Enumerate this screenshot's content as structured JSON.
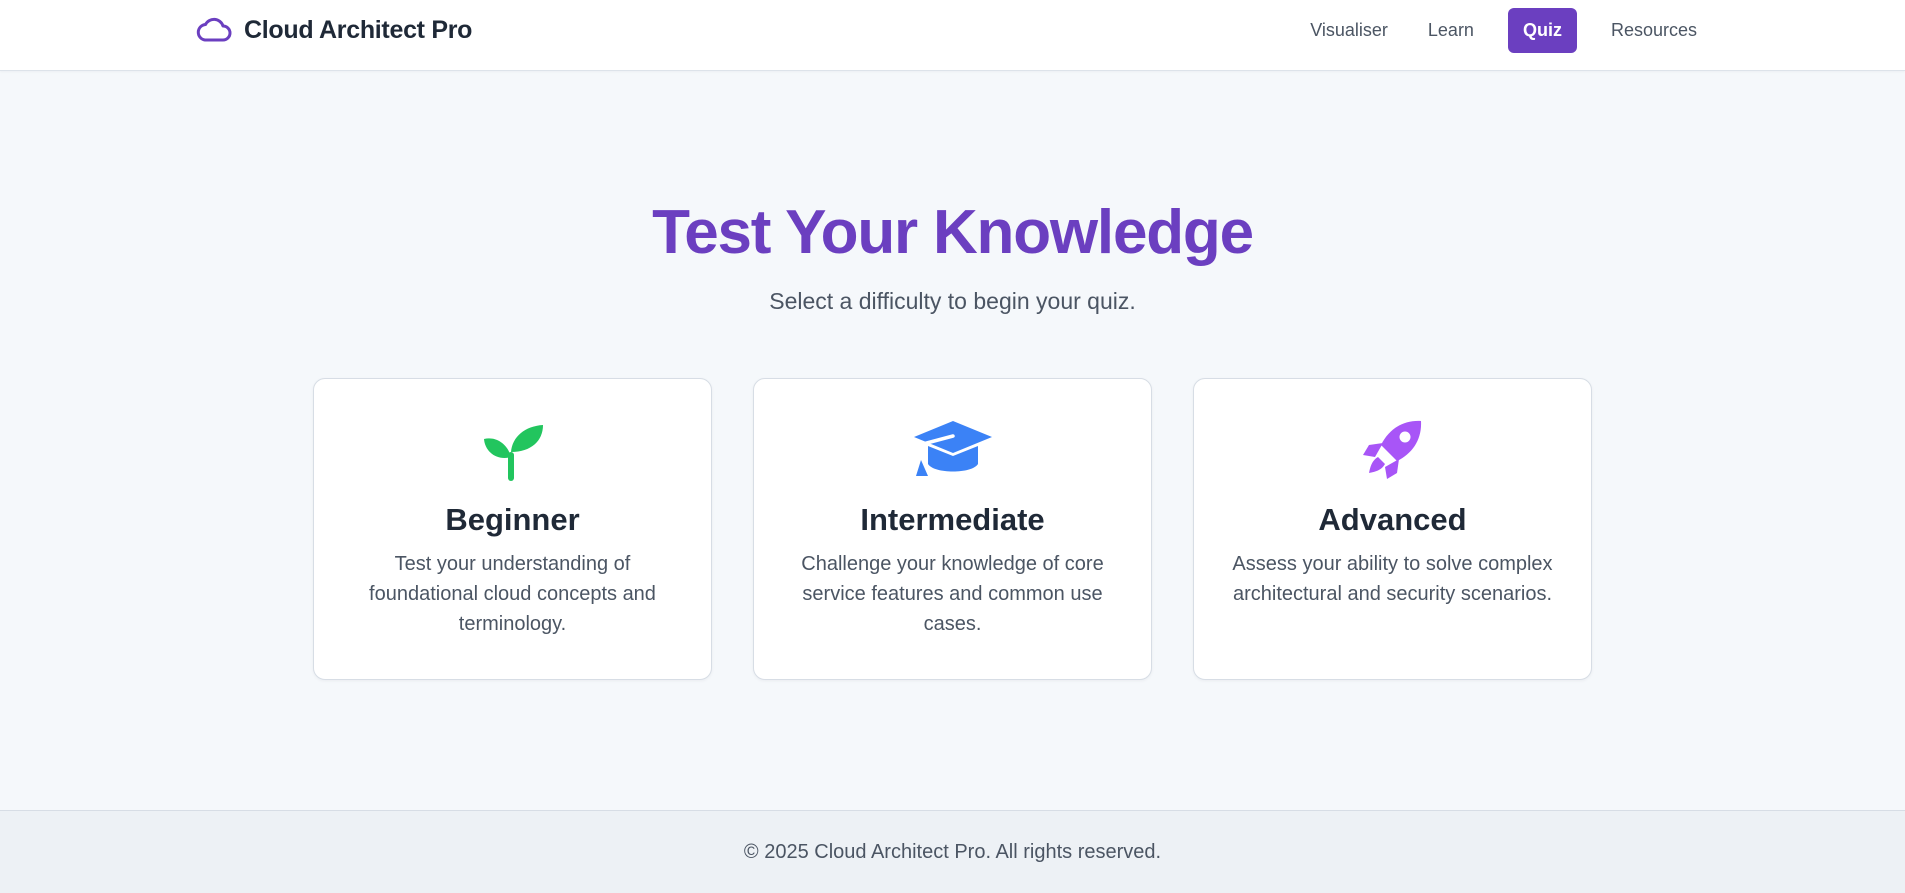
{
  "header": {
    "brand_name": "Cloud Architect Pro",
    "brand_icon": "cloud-icon",
    "nav": [
      {
        "label": "Visualiser",
        "active": false
      },
      {
        "label": "Learn",
        "active": false
      },
      {
        "label": "Quiz",
        "active": true
      },
      {
        "label": "Resources",
        "active": false
      }
    ]
  },
  "hero": {
    "title": "Test Your Knowledge",
    "subtitle": "Select a difficulty to begin your quiz."
  },
  "cards": [
    {
      "title": "Beginner",
      "description": "Test your understanding of foundational cloud concepts and terminology.",
      "icon": "seedling-icon",
      "icon_color": "#22c55e"
    },
    {
      "title": "Intermediate",
      "description": "Challenge your knowledge of core service features and common use cases.",
      "icon": "graduation-cap-icon",
      "icon_color": "#3b82f6"
    },
    {
      "title": "Advanced",
      "description": "Assess your ability to solve complex architectural and security scenarios.",
      "icon": "rocket-icon",
      "icon_color": "#a855f7"
    }
  ],
  "footer": {
    "text": "© 2025 Cloud Architect Pro. All rights reserved."
  },
  "colors": {
    "accent": "#6b3fc0",
    "background": "#f5f8fb",
    "text_dark": "#1f2937",
    "text_muted": "#4b5563"
  }
}
